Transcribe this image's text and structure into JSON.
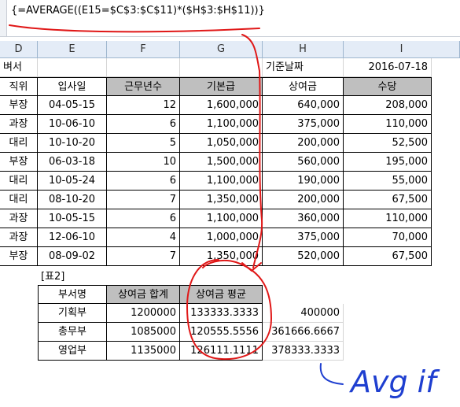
{
  "formula_bar": {
    "text": "{=AVERAGE((E15=$C$3:$C$11)*($H$3:$H$11))}"
  },
  "columns": [
    "D",
    "E",
    "F",
    "G",
    "H",
    "I"
  ],
  "row_title": {
    "d": "벼서",
    "h": "기준날짜",
    "i": "2016-07-18"
  },
  "headers": [
    "직위",
    "입사일",
    "근무년수",
    "기본급",
    "상여금",
    "수당"
  ],
  "rows": [
    [
      "부장",
      "04-05-15",
      "12",
      "1,600,000",
      "640,000",
      "208,000"
    ],
    [
      "과장",
      "10-06-10",
      "6",
      "1,100,000",
      "375,000",
      "110,000"
    ],
    [
      "대리",
      "10-10-20",
      "5",
      "1,050,000",
      "200,000",
      "52,500"
    ],
    [
      "부장",
      "06-03-18",
      "10",
      "1,500,000",
      "560,000",
      "195,000"
    ],
    [
      "대리",
      "10-05-24",
      "6",
      "1,100,000",
      "190,000",
      "55,000"
    ],
    [
      "대리",
      "08-10-20",
      "7",
      "1,350,000",
      "200,000",
      "67,500"
    ],
    [
      "과장",
      "10-05-15",
      "6",
      "1,100,000",
      "360,000",
      "110,000"
    ],
    [
      "과장",
      "12-06-10",
      "4",
      "1,000,000",
      "375,000",
      "70,000"
    ],
    [
      "부장",
      "08-09-02",
      "7",
      "1,350,000",
      "520,000",
      "67,500"
    ]
  ],
  "table2": {
    "label": "[표2]",
    "headers": [
      "부서명",
      "상여금 합계",
      "상여금 평균"
    ],
    "rows": [
      [
        "기획부",
        "1200000",
        "133333.3333",
        "400000"
      ],
      [
        "총무부",
        "1085000",
        "120555.5556",
        "361666.6667"
      ],
      [
        "영업부",
        "1135000",
        "126111.1111",
        "378333.3333"
      ]
    ]
  },
  "annotation": {
    "text": "Avg if",
    "color": "#1f3fd0"
  },
  "ink_color": "#e01818"
}
